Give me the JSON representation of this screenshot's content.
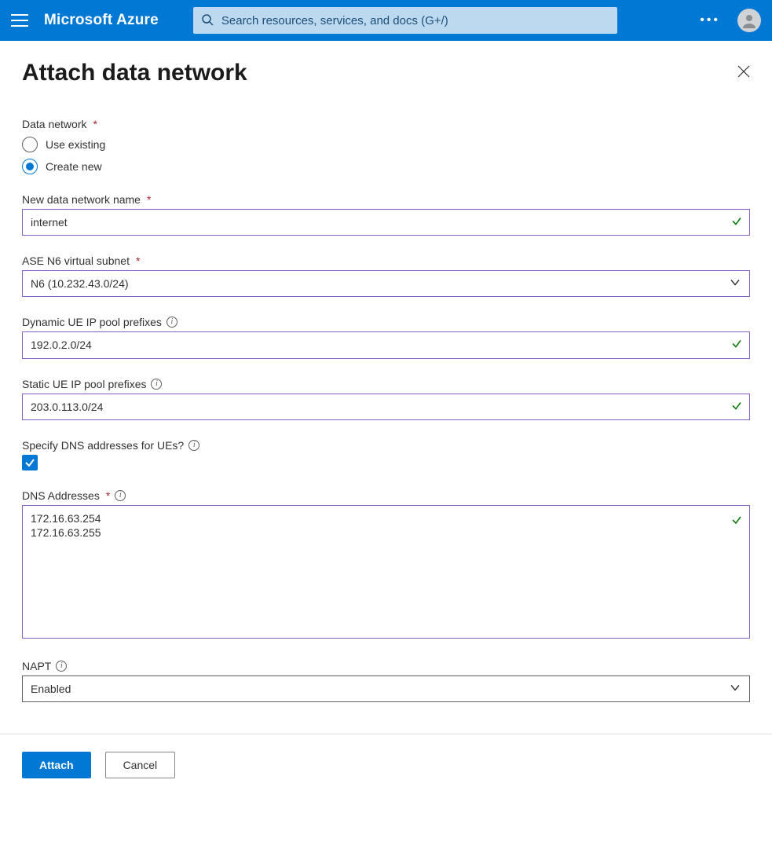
{
  "header": {
    "brand": "Microsoft Azure",
    "search_placeholder": "Search resources, services, and docs (G+/)"
  },
  "page": {
    "title": "Attach data network"
  },
  "form": {
    "data_network": {
      "label": "Data network",
      "opt_existing": "Use existing",
      "opt_new": "Create new",
      "selected": "new"
    },
    "new_name": {
      "label": "New data network name",
      "value": "internet"
    },
    "subnet": {
      "label": "ASE N6 virtual subnet",
      "value": "N6 (10.232.43.0/24)"
    },
    "dynamic_pool": {
      "label": "Dynamic UE IP pool prefixes",
      "value": "192.0.2.0/24"
    },
    "static_pool": {
      "label": "Static UE IP pool prefixes",
      "value": "203.0.113.0/24"
    },
    "specify_dns": {
      "label": "Specify DNS addresses for UEs?",
      "checked": true
    },
    "dns_addresses": {
      "label": "DNS Addresses",
      "value": "172.16.63.254\n172.16.63.255"
    },
    "napt": {
      "label": "NAPT",
      "value": "Enabled"
    }
  },
  "footer": {
    "primary": "Attach",
    "secondary": "Cancel"
  }
}
